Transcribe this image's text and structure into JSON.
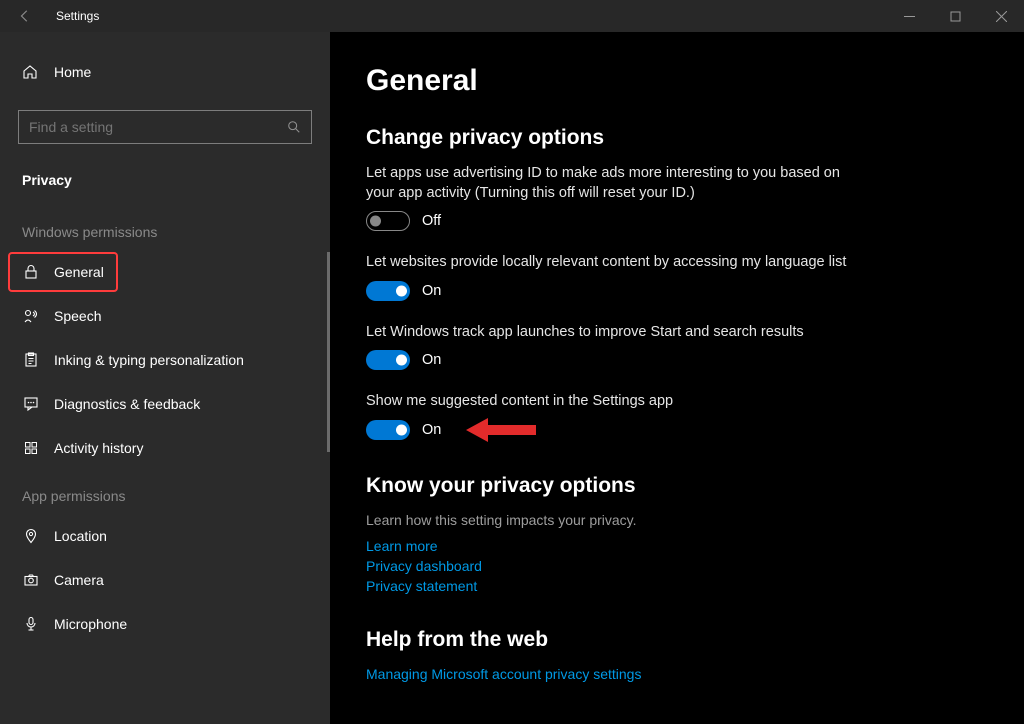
{
  "window": {
    "title": "Settings"
  },
  "sidebar": {
    "home": "Home",
    "search_placeholder": "Find a setting",
    "category": "Privacy",
    "section_windows": "Windows permissions",
    "section_app": "App permissions",
    "windows_items": [
      {
        "icon": "lock",
        "label": "General",
        "selected": true
      },
      {
        "icon": "speech",
        "label": "Speech",
        "selected": false
      },
      {
        "icon": "clipboard",
        "label": "Inking & typing personalization",
        "selected": false
      },
      {
        "icon": "feedback",
        "label": "Diagnostics & feedback",
        "selected": false
      },
      {
        "icon": "history",
        "label": "Activity history",
        "selected": false
      }
    ],
    "app_items": [
      {
        "icon": "location",
        "label": "Location"
      },
      {
        "icon": "camera",
        "label": "Camera"
      },
      {
        "icon": "mic",
        "label": "Microphone"
      }
    ]
  },
  "content": {
    "heading": "General",
    "privacy_options_heading": "Change privacy options",
    "settings": [
      {
        "desc": "Let apps use advertising ID to make ads more interesting to you based on your app activity (Turning this off will reset your ID.)",
        "state": "off",
        "state_label": "Off"
      },
      {
        "desc": "Let websites provide locally relevant content by accessing my language list",
        "state": "on",
        "state_label": "On"
      },
      {
        "desc": "Let Windows track app launches to improve Start and search results",
        "state": "on",
        "state_label": "On"
      },
      {
        "desc": "Show me suggested content in the Settings app",
        "state": "on",
        "state_label": "On",
        "highlighted": true
      }
    ],
    "know_heading": "Know your privacy options",
    "know_desc": "Learn how this setting impacts your privacy.",
    "links": [
      "Learn more",
      "Privacy dashboard",
      "Privacy statement"
    ],
    "help_heading": "Help from the web",
    "help_links": [
      "Managing Microsoft account privacy settings"
    ]
  }
}
